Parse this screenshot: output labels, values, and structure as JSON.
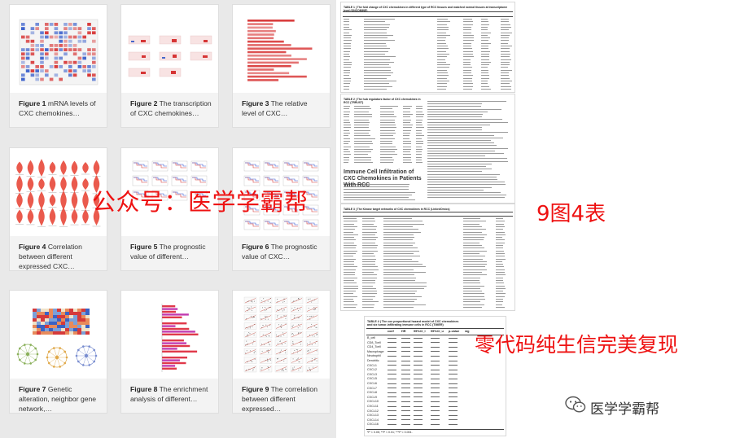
{
  "figures": [
    {
      "fig": "Figure 1",
      "text": " mRNA levels of CXC chemokines…"
    },
    {
      "fig": "Figure 2",
      "text": " The transcription of CXC chemokines…"
    },
    {
      "fig": "Figure 3",
      "text": " The relative level of CXC…"
    },
    {
      "fig": "Figure 4",
      "text": " Correlation between different expressed CXC…"
    },
    {
      "fig": "Figure 5",
      "text": " The prognostic value of different…"
    },
    {
      "fig": "Figure 6",
      "text": " The prognostic value of CXC…"
    },
    {
      "fig": "Figure 7",
      "text": " Genetic alteration, neighbor gene network,…"
    },
    {
      "fig": "Figure 8",
      "text": " The enrichment analysis of different…"
    },
    {
      "fig": "Figure 9",
      "text": " The correlation between different expressed…"
    }
  ],
  "tables": {
    "t1_title": "TABLE 1 | The fold change of CXC chemokines in different type of RCC tissues and matched normal tissues at transcriptome level (ONCOMINE)",
    "t2_title": "TABLE 2 | The hub regulators factor of CXC chemokines in RCC (TRRUST)",
    "t2_section": "Immune Cell Infiltration of CXC Chemokines in Patients With RCC",
    "t3_title": "TABLE 3 | The Kinase target networks of CXC chemokines in RCC (LinkedOmics)",
    "t4_title": "TABLE 4 | The cox proportional hazard model of CXC chemokines and six tumor-infiltrating immune cells in RCC (TIMER)",
    "t4_header": [
      "coef",
      "HR",
      "95%CI_l",
      "95%CI_u",
      "p-value",
      "sig"
    ],
    "t4_rows": [
      "B_cell",
      "CD8_Tcell",
      "CD4_Tcell",
      "Macrophage",
      "Neutrophil",
      "Dendritic",
      "CXCL1",
      "CXCL2",
      "CXCL3",
      "CXCL5",
      "CXCL6",
      "CXCL7",
      "CXCL8",
      "CXCL9",
      "CXCL10",
      "CXCL11",
      "CXCL12",
      "CXCL13",
      "CXCL14",
      "CXCL16"
    ],
    "t4_footnote": "*P < 0.05; **P < 0.01; ***P < 0.001."
  },
  "watermarks": {
    "gzh": "公众号：医学学霸帮",
    "count": "9图4表",
    "zero_code": "零代码纯生信完美复现"
  },
  "brand": {
    "name": "医学学霸帮",
    "icon": "wechat-icon"
  },
  "colors": {
    "watermark_red": "#ee1111",
    "heat_red": "#d62d2d",
    "heat_blue": "#2f57c9"
  }
}
